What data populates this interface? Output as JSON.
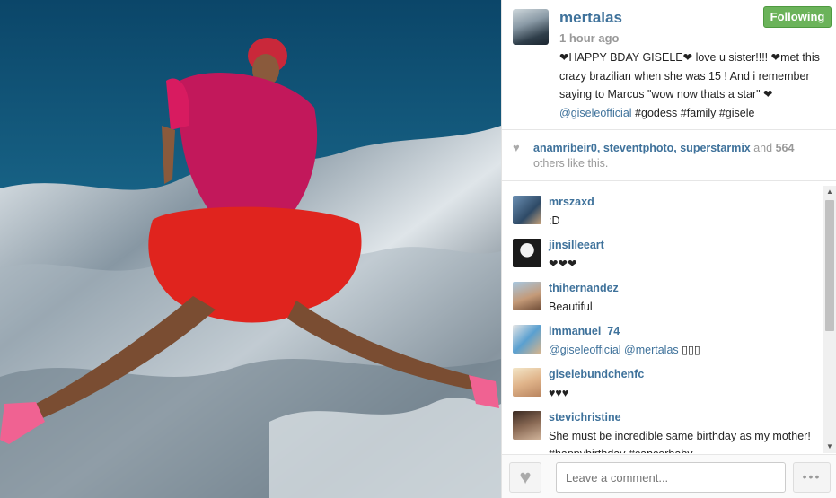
{
  "post": {
    "username": "mertalas",
    "time": "1 hour ago",
    "follow_label": "Following",
    "caption_main": "❤HAPPY BDAY GISELE❤ love u sister!!!! ❤met this crazy brazilian when she was 15 ! And i remember saying to Marcus \"wow now thats a star\" ❤ ",
    "caption_mention": "@giseleofficial",
    "caption_tags": " #godess #family #gisele"
  },
  "likes": {
    "users": "anamribeir0, steventphoto, superstarmix",
    "and": " and ",
    "count": "564",
    "others": "others like this."
  },
  "comments": [
    {
      "user": "mrszaxd",
      "text": ":D"
    },
    {
      "user": "jinsilleeart",
      "text": "❤❤❤"
    },
    {
      "user": "thihernandez",
      "text": "Beautiful"
    },
    {
      "user": "immanuel_74",
      "mention": "@giseleofficial @mertalas",
      "text": " ▯▯▯"
    },
    {
      "user": "giselebundchenfc",
      "text": "♥♥♥"
    },
    {
      "user": "stevichristine",
      "text": "She must be incredible same birthday as my mother! #happybirthday #cancerbaby"
    }
  ],
  "footer": {
    "comment_placeholder": "Leave a comment...",
    "more_label": "•••"
  },
  "colors": {
    "link": "#3f729b",
    "following_green": "#6bb35a"
  }
}
